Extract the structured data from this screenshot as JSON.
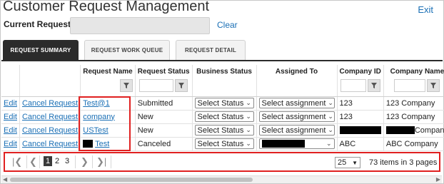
{
  "header": {
    "title": "Customer Request Management",
    "exit_label": "Exit",
    "current_request_label": "Current Request",
    "current_request_value": "",
    "clear_label": "Clear"
  },
  "tabs": [
    {
      "label": "REQUEST SUMMARY",
      "active": true
    },
    {
      "label": "REQUEST WORK QUEUE",
      "active": false
    },
    {
      "label": "REQUEST DETAIL",
      "active": false
    }
  ],
  "table": {
    "columns": [
      "",
      "",
      "Request Name",
      "Request Status",
      "Business Status",
      "Assigned To",
      "Company ID",
      "Company Name"
    ],
    "rows": [
      {
        "edit": "Edit",
        "cancel": "Cancel Request",
        "name": "Test@1",
        "status": "Submitted",
        "business_status": "Select Status",
        "assigned": "Select assignment",
        "company_id": "123",
        "company_name": "123 Company"
      },
      {
        "edit": "Edit",
        "cancel": "Cancel Request",
        "name": "company",
        "status": "New",
        "business_status": "Select Status",
        "assigned": "Select assignment",
        "company_id": "123",
        "company_name": "123 Company"
      },
      {
        "edit": "Edit",
        "cancel": "Cancel Request",
        "name": "USTest",
        "status": "New",
        "business_status": "Select Status",
        "assigned": "Select assignment",
        "company_id": "",
        "company_name": "Company"
      },
      {
        "edit": "Edit",
        "cancel": "Cancel Request",
        "name": "Test",
        "status": "Canceled",
        "business_status": "Select Status",
        "assigned": "",
        "company_id": "ABC",
        "company_name": "ABC Company"
      }
    ]
  },
  "pager": {
    "pages": [
      "1",
      "2",
      "3"
    ],
    "current_page": "1",
    "page_size": "25",
    "info": "73 items in 3 pages"
  },
  "icons": {
    "filter": "filter-icon",
    "first": "first-page-icon",
    "prev": "prev-page-icon",
    "next": "next-page-icon",
    "last": "last-page-icon",
    "dropdown": "chevron-down-icon"
  },
  "colors": {
    "link": "#1a6fb5",
    "active_tab": "#2b2b2b",
    "highlight": "#e02020"
  }
}
